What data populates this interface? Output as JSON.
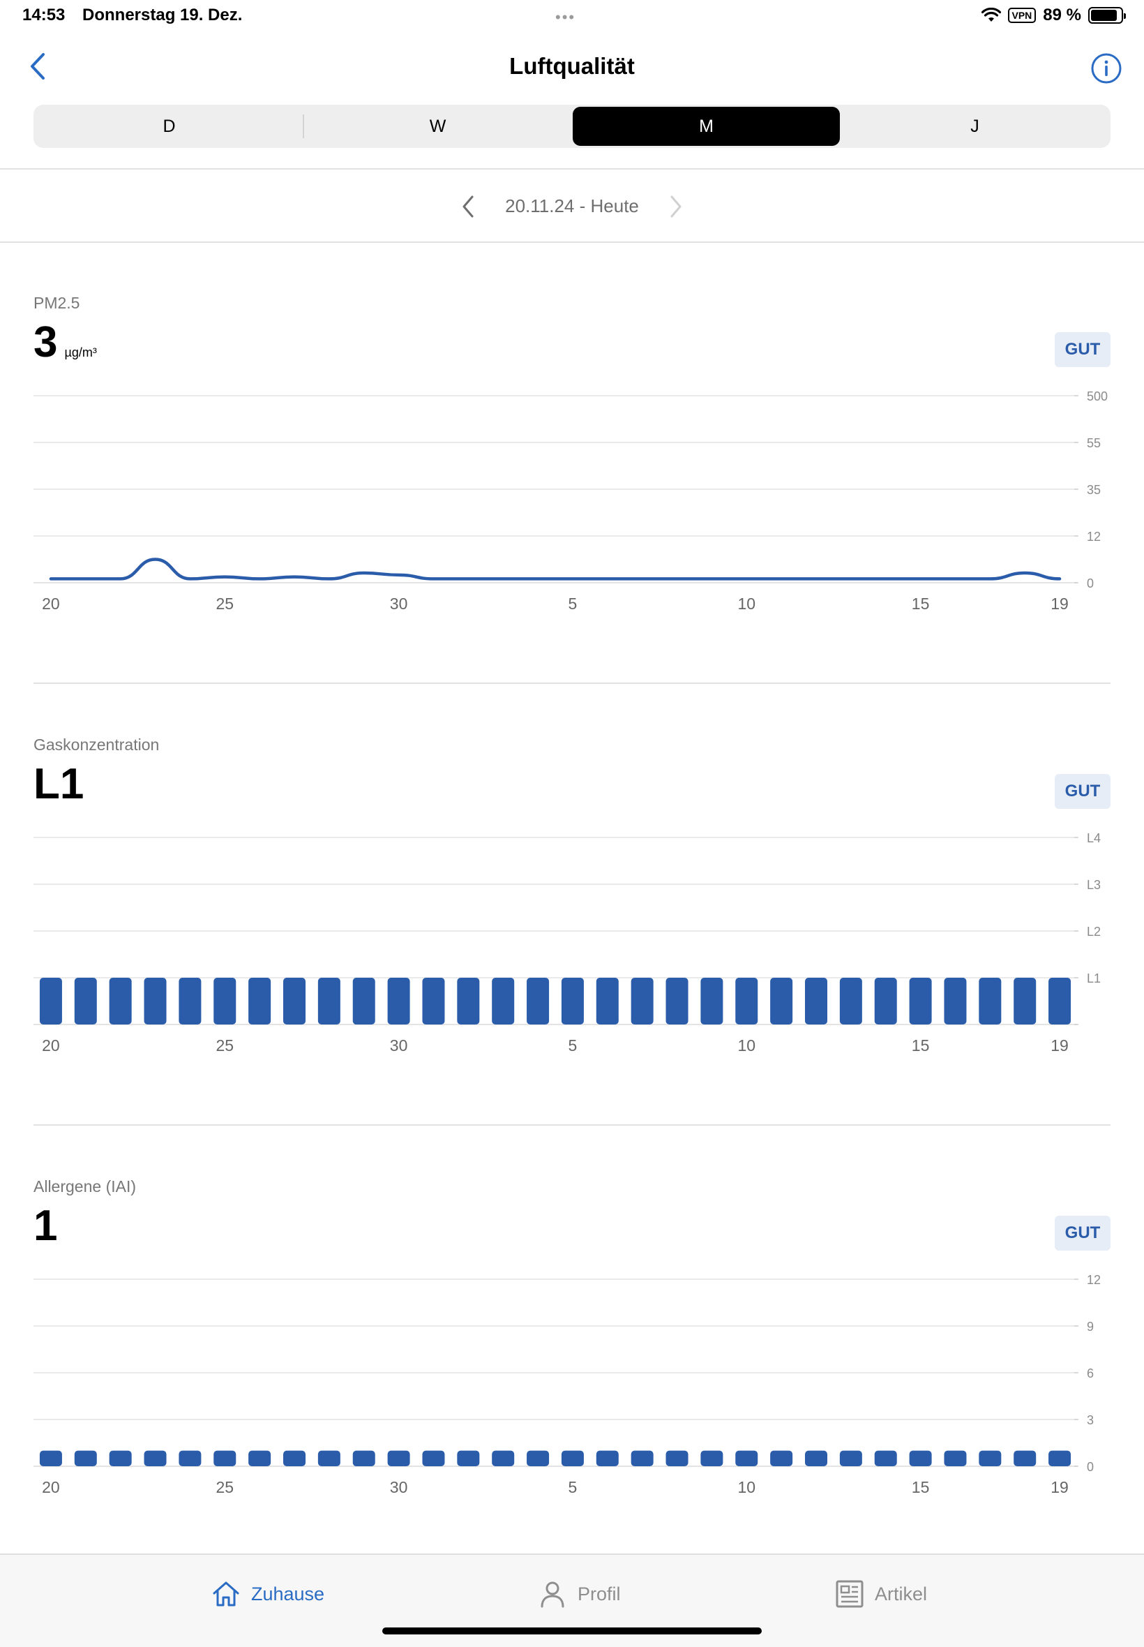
{
  "status_bar": {
    "time": "14:53",
    "date": "Donnerstag 19. Dez.",
    "dots": "•••",
    "vpn": "VPN",
    "battery_text": "89 %",
    "battery_level": 0.89
  },
  "nav": {
    "title": "Luftqualität",
    "back_icon": "chevron-left-icon",
    "info_icon": "info-circle-icon"
  },
  "segments": [
    {
      "label": "D",
      "active": false
    },
    {
      "label": "W",
      "active": false
    },
    {
      "label": "M",
      "active": true
    },
    {
      "label": "J",
      "active": false
    }
  ],
  "date_range": {
    "text": "20.11.24 - Heute"
  },
  "colors": {
    "accent": "#2a5caa",
    "tab_active": "#2a6cc4",
    "badge_bg": "#e6edf7"
  },
  "sections": {
    "pm25": {
      "label": "PM2.5",
      "value": "3",
      "unit": "µg/m³",
      "badge": "GUT"
    },
    "gas": {
      "label": "Gaskonzentration",
      "value": "L1",
      "badge": "GUT"
    },
    "allergens": {
      "label": "Allergene (IAI)",
      "value": "1",
      "badge": "GUT"
    }
  },
  "chart_data": [
    {
      "type": "line",
      "title": "PM2.5",
      "x": [
        "20",
        "21",
        "22",
        "23",
        "24",
        "25",
        "26",
        "27",
        "28",
        "29",
        "30",
        "1",
        "2",
        "3",
        "4",
        "5",
        "6",
        "7",
        "8",
        "9",
        "10",
        "11",
        "12",
        "13",
        "14",
        "15",
        "16",
        "17",
        "18",
        "19"
      ],
      "x_tick_labels": [
        "20",
        "25",
        "30",
        "5",
        "10",
        "15",
        "19"
      ],
      "y_tick_labels": [
        "0",
        "12",
        "35",
        "55",
        "500"
      ],
      "values": [
        1,
        1,
        1,
        6,
        1,
        1.5,
        1,
        1.5,
        1,
        2.5,
        2,
        1,
        1,
        1,
        1,
        1,
        1,
        1,
        1,
        1,
        1,
        1,
        1,
        1,
        1,
        1,
        1,
        1,
        2.5,
        1
      ],
      "grid": true
    },
    {
      "type": "bar",
      "title": "Gaskonzentration",
      "x": [
        "20",
        "21",
        "22",
        "23",
        "24",
        "25",
        "26",
        "27",
        "28",
        "29",
        "30",
        "1",
        "2",
        "3",
        "4",
        "5",
        "6",
        "7",
        "8",
        "9",
        "10",
        "11",
        "12",
        "13",
        "14",
        "15",
        "16",
        "17",
        "18",
        "19"
      ],
      "x_tick_labels": [
        "20",
        "25",
        "30",
        "5",
        "10",
        "15",
        "19"
      ],
      "y_tick_labels": [
        "L1",
        "L2",
        "L3",
        "L4"
      ],
      "values": [
        1,
        1,
        1,
        1,
        1,
        1,
        1,
        1,
        1,
        1,
        1,
        1,
        1,
        1,
        1,
        1,
        1,
        1,
        1,
        1,
        1,
        1,
        1,
        1,
        1,
        1,
        1,
        1,
        1,
        1
      ],
      "grid": true
    },
    {
      "type": "bar",
      "title": "Allergene (IAI)",
      "x": [
        "20",
        "21",
        "22",
        "23",
        "24",
        "25",
        "26",
        "27",
        "28",
        "29",
        "30",
        "1",
        "2",
        "3",
        "4",
        "5",
        "6",
        "7",
        "8",
        "9",
        "10",
        "11",
        "12",
        "13",
        "14",
        "15",
        "16",
        "17",
        "18",
        "19"
      ],
      "x_tick_labels": [
        "20",
        "25",
        "30",
        "5",
        "10",
        "15",
        "19"
      ],
      "y_tick_labels": [
        "0",
        "3",
        "6",
        "9",
        "12"
      ],
      "values": [
        1,
        1,
        1,
        1,
        1,
        1,
        1,
        1,
        1,
        1,
        1,
        1,
        1,
        1,
        1,
        1,
        1,
        1,
        1,
        1,
        1,
        1,
        1,
        1,
        1,
        1,
        1,
        1,
        1,
        1
      ],
      "grid": true
    }
  ],
  "tabs": [
    {
      "label": "Zuhause",
      "icon": "home-icon",
      "active": true
    },
    {
      "label": "Profil",
      "icon": "person-icon",
      "active": false
    },
    {
      "label": "Artikel",
      "icon": "article-icon",
      "active": false
    }
  ]
}
